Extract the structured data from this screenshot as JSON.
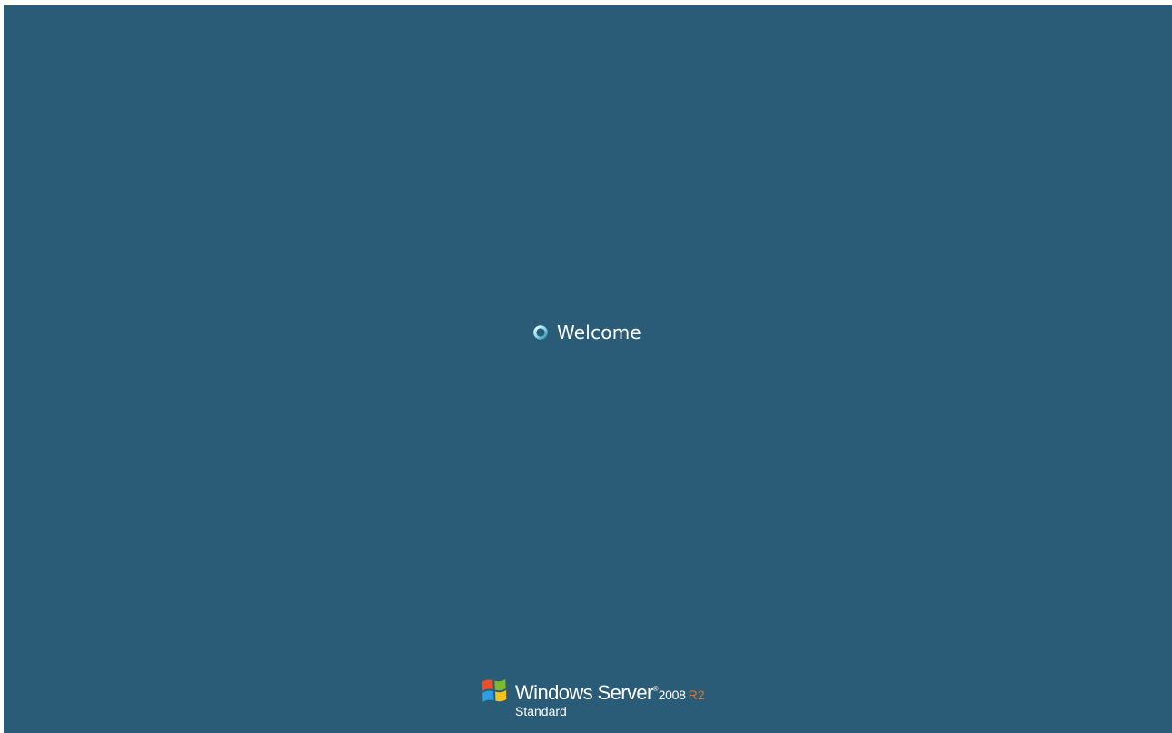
{
  "status": {
    "message": "Welcome",
    "indicator_icon": "busy-spinner-icon"
  },
  "branding": {
    "logo_icon": "windows-flag-icon",
    "product": "Windows Server",
    "trademark": "®",
    "version": "2008",
    "release": "R2",
    "edition": "Standard"
  },
  "colors": {
    "background": "#2a5c78",
    "text": "#ffffff",
    "release_accent": "#e0732b",
    "spinner": "#7fd6e8"
  }
}
